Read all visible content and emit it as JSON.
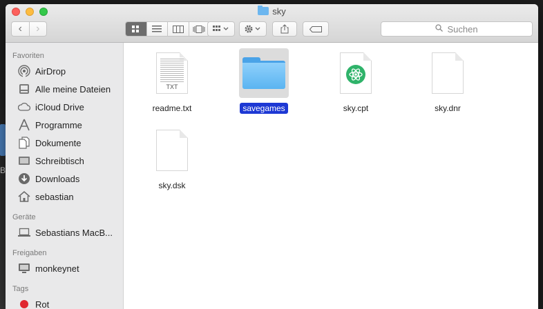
{
  "window": {
    "title": "sky"
  },
  "toolbar": {
    "back_glyph": "‹",
    "forward_glyph": "›",
    "search_placeholder": "Suchen"
  },
  "sidebar": {
    "sections": [
      {
        "heading": "Favoriten",
        "items": [
          {
            "label": "AirDrop",
            "icon": "airdrop-icon"
          },
          {
            "label": "Alle meine Dateien",
            "icon": "all-files-icon"
          },
          {
            "label": "iCloud Drive",
            "icon": "cloud-icon"
          },
          {
            "label": "Programme",
            "icon": "applications-icon"
          },
          {
            "label": "Dokumente",
            "icon": "documents-icon"
          },
          {
            "label": "Schreibtisch",
            "icon": "desktop-icon"
          },
          {
            "label": "Downloads",
            "icon": "downloads-icon"
          },
          {
            "label": "sebastian",
            "icon": "home-icon"
          }
        ]
      },
      {
        "heading": "Geräte",
        "items": [
          {
            "label": "Sebastians MacB...",
            "icon": "laptop-icon"
          }
        ]
      },
      {
        "heading": "Freigaben",
        "items": [
          {
            "label": "monkeynet",
            "icon": "monitor-icon"
          }
        ]
      },
      {
        "heading": "Tags",
        "items": [
          {
            "label": "Rot",
            "icon": "red-tag-icon",
            "color": "#e0262f"
          }
        ]
      }
    ]
  },
  "files": [
    {
      "name": "readme.txt",
      "kind": "text",
      "ext": "TXT"
    },
    {
      "name": "savegames",
      "kind": "folder",
      "selected": true
    },
    {
      "name": "sky.cpt",
      "kind": "app-doc"
    },
    {
      "name": "sky.dnr",
      "kind": "blank"
    },
    {
      "name": "sky.dsk",
      "kind": "blank"
    }
  ],
  "desktop": {
    "partial_label": "Ba"
  },
  "colors": {
    "selection": "#1d38d4",
    "folder": "#5ab4f1",
    "app_badge": "#2fb36a"
  }
}
